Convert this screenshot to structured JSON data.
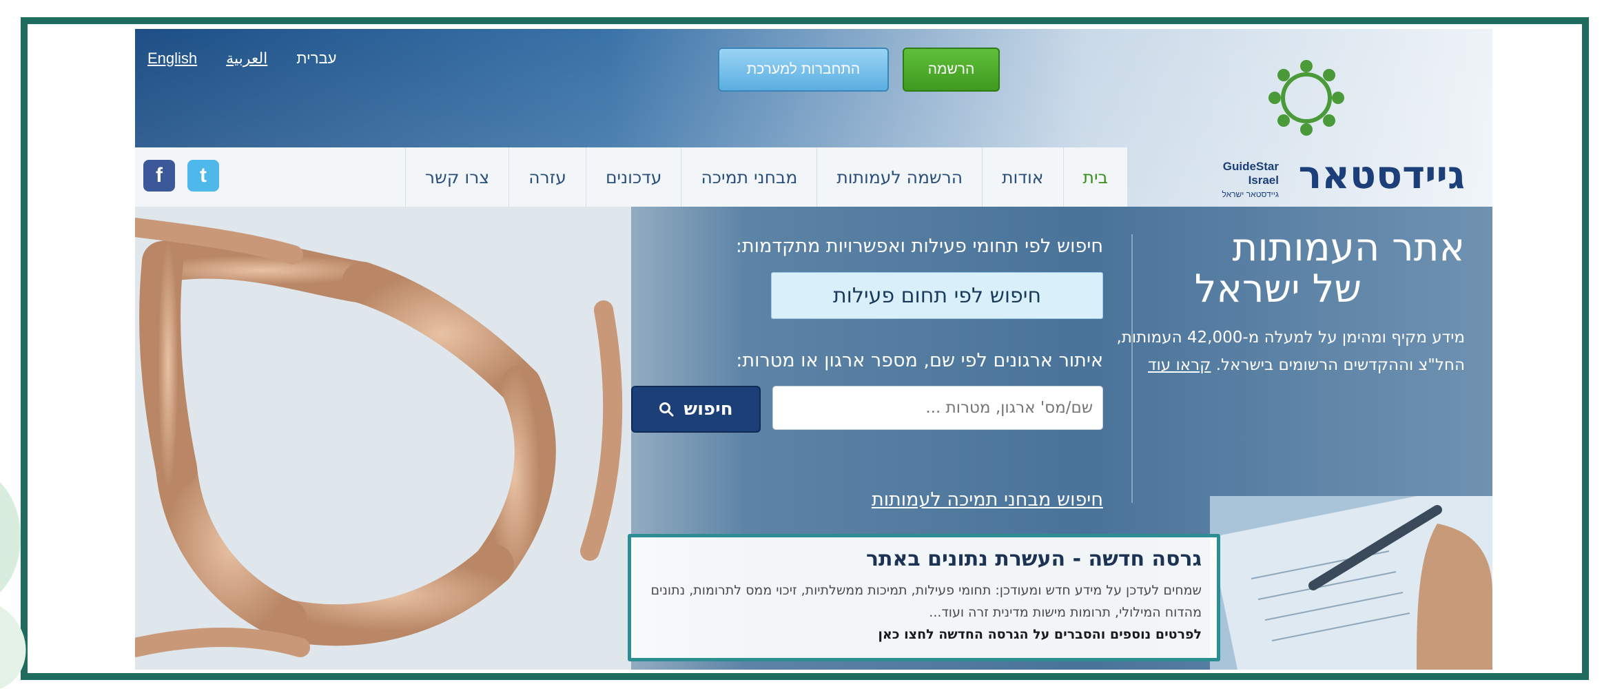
{
  "languages": {
    "english": "English",
    "arabic": "العربية",
    "hebrew": "עברית"
  },
  "header": {
    "register_label": "הרשמה",
    "login_label": "התחברות למערכת",
    "logo_hebrew": "גיידסטאר",
    "logo_english": "GuideStar",
    "logo_english_sub": "Israel",
    "logo_small_sub": "גיידסטאר ישראל"
  },
  "nav": {
    "items": [
      {
        "label": "בית"
      },
      {
        "label": "אודות"
      },
      {
        "label": "הרשמה לעמותות"
      },
      {
        "label": "מבחני תמיכה"
      },
      {
        "label": "עדכונים"
      },
      {
        "label": "עזרה"
      },
      {
        "label": "צרו קשר"
      }
    ]
  },
  "social": {
    "facebook": "f",
    "twitter": "t"
  },
  "hero": {
    "title_line1": "אתר העמותות",
    "title_line2": "של ישראל",
    "description": "מידע מקיף ומהימן על למעלה מ-42,000 העמותות, החל\"צ וההקדשים הרשומים בישראל.",
    "read_more": "קראו עוד"
  },
  "search": {
    "activity_heading": "חיפוש לפי תחומי פעילות ואפשרויות מתקדמות:",
    "activity_button": "חיפוש לפי תחום פעילות",
    "org_heading": "איתור ארגונים לפי שם, מספר ארגון או מטרות:",
    "placeholder": "שם/מס' ארגון, מטרות ...",
    "search_button": "חיפוש",
    "support_link": "חיפוש מבחני תמיכה לעמותות"
  },
  "news": {
    "title": "גרסה חדשה - העשרת נתונים באתר",
    "body": "שמחים לעדכן על מידע חדש ומעודכן: תחומי פעילות, תמיכות ממשלתיות, זיכוי ממס לתרומות, נתונים מהדוח המילולי, תרומות מישות מדינית זרה ועוד...",
    "link": "לפרטים נוספים והסברים על הגרסה החדשה לחצו כאן"
  },
  "colors": {
    "frame": "#1f6b5e",
    "brand_green": "#3f9a1f",
    "brand_blue": "#1c3f78"
  }
}
